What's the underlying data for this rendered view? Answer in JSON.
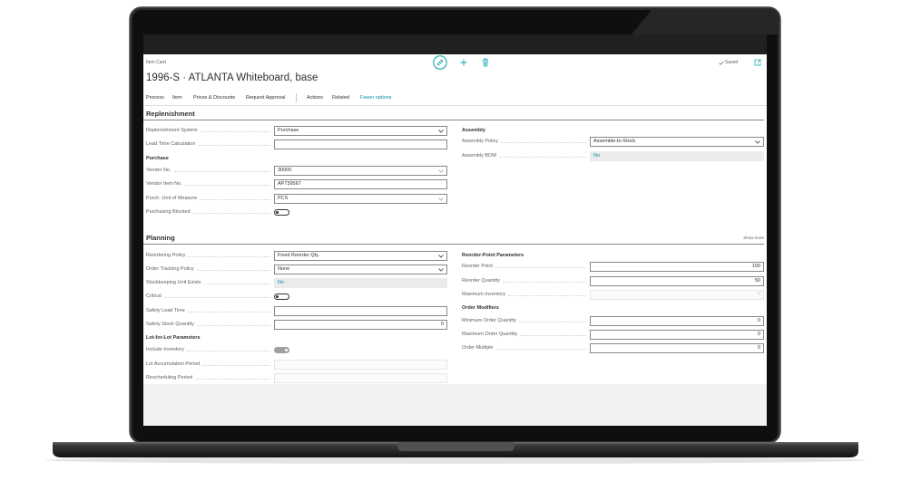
{
  "header": {
    "caption": "Item Card",
    "title": "1996-S · ATLANTA Whiteboard, base",
    "saved_label": "Saved"
  },
  "action_bar": {
    "process": "Process",
    "item": "Item",
    "prices_discounts": "Prices & Discounts",
    "request_approval": "Request Approval",
    "actions": "Actions",
    "related": "Related",
    "fewer_options": "Fewer options"
  },
  "replenishment": {
    "title": "Replenishment",
    "replenishment_system": {
      "label": "Replenishment System",
      "value": "Purchase"
    },
    "lead_time_calculation": {
      "label": "Lead Time Calculation",
      "value": ""
    },
    "purchase_group": "Purchase",
    "vendor_no": {
      "label": "Vendor No.",
      "value": "30000"
    },
    "vendor_item_no": {
      "label": "Vendor Item No.",
      "value": "AP739567"
    },
    "purch_unit_of_measure": {
      "label": "Purch. Unit of Measure",
      "value": "PCS"
    },
    "purchasing_blocked": {
      "label": "Purchasing Blocked",
      "value": false
    },
    "assembly_group": "Assembly",
    "assembly_policy": {
      "label": "Assembly Policy",
      "value": "Assemble-to-Stock"
    },
    "assembly_bom": {
      "label": "Assembly BOM",
      "value": "No"
    }
  },
  "planning": {
    "title": "Planning",
    "show_more": "Show more",
    "reordering_policy": {
      "label": "Reordering Policy",
      "value": "Fixed Reorder Qty."
    },
    "order_tracking_policy": {
      "label": "Order Tracking Policy",
      "value": "None"
    },
    "stockkeeping_unit_exists": {
      "label": "Stockkeeping Unit Exists",
      "value": "No"
    },
    "critical": {
      "label": "Critical",
      "value": false
    },
    "safety_lead_time": {
      "label": "Safety Lead Time",
      "value": ""
    },
    "safety_stock_quantity": {
      "label": "Safety Stock Quantity",
      "value": "0"
    },
    "lot_for_lot_group": "Lot-for-Lot Parameters",
    "include_inventory": {
      "label": "Include Inventory",
      "value": true,
      "enabled": false
    },
    "lot_accumulation_period": {
      "label": "Lot Accumulation Period",
      "value": ""
    },
    "rescheduling_period": {
      "label": "Rescheduling Period",
      "value": ""
    },
    "reorder_point_group": "Reorder-Point Parameters",
    "reorder_point": {
      "label": "Reorder Point",
      "value": "100"
    },
    "reorder_quantity": {
      "label": "Reorder Quantity",
      "value": "50"
    },
    "maximum_inventory": {
      "label": "Maximum Inventory",
      "value": "0"
    },
    "order_modifiers_group": "Order Modifiers",
    "minimum_order_quantity": {
      "label": "Minimum Order Quantity",
      "value": "0"
    },
    "maximum_order_quantity": {
      "label": "Maximum Order Quantity",
      "value": "0"
    },
    "order_multiple": {
      "label": "Order Multiple",
      "value": "0"
    }
  },
  "icons": {
    "edit": "edit-icon",
    "add": "add-icon",
    "delete": "delete-icon",
    "saved": "check-icon",
    "expand": "expand-icon",
    "dropdown": "chevron-down-icon"
  },
  "colors": {
    "accent": "#00a0a8",
    "text": "#323130",
    "label": "#605e5c",
    "laptop_body": "#1c1c1e"
  }
}
